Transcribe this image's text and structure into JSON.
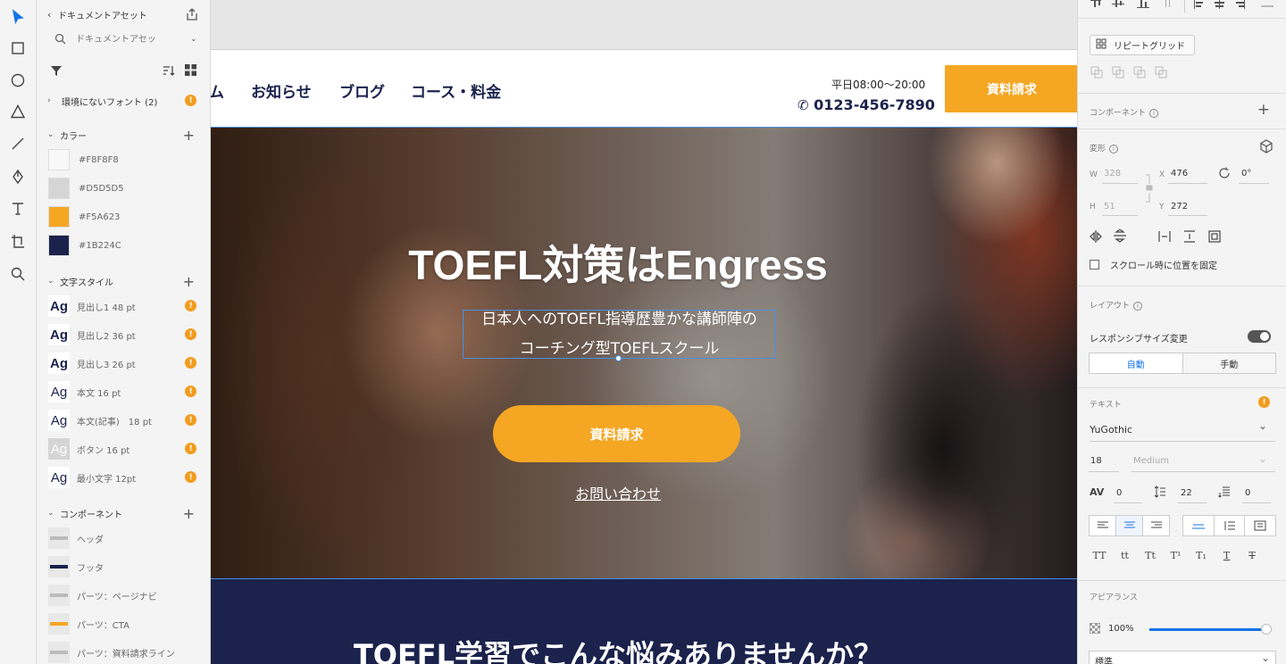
{
  "assets": {
    "back_label": "ドキュメントアセット",
    "search_placeholder": "ドキュメントアセッ",
    "missing_fonts": "環境にないフォント (2)",
    "colors_title": "カラー",
    "colors": [
      "#F8F8F8",
      "#D5D5D5",
      "#F5A623",
      "#1B224C"
    ],
    "char_styles_title": "文字スタイル",
    "char_styles": [
      {
        "glyph": "Ag",
        "label": "見出し1 48 pt",
        "weight": "bold"
      },
      {
        "glyph": "Ag",
        "label": "見出し2 36 pt",
        "weight": "bold"
      },
      {
        "glyph": "Ag",
        "label": "見出し3 26 pt",
        "weight": "bold"
      },
      {
        "glyph": "Ag",
        "label": "本文 16 pt",
        "weight": "normal"
      },
      {
        "glyph": "Ag",
        "label": "本文(記事)　18 pt",
        "weight": "normal"
      },
      {
        "glyph": "Ag",
        "label": "ボタン 16 pt",
        "weight": "normal",
        "muted": true
      },
      {
        "glyph": "Ag",
        "label": "最小文字 12pt",
        "weight": "normal"
      }
    ],
    "components_title": "コンポーネント",
    "components": [
      "ヘッダ",
      "フッタ",
      "パーツ：ページナビ",
      "パーツ：CTA",
      "パーツ：資料請求ライン"
    ]
  },
  "site": {
    "nav": [
      "ム",
      "お知らせ",
      "ブログ",
      "コース・料金"
    ],
    "hours": "平日08:00〜20:00",
    "phone": "0123-456-7890",
    "header_cta": "資料請求",
    "hero_title": "TOEFL対策はEngress",
    "hero_sub_1": "日本人へのTOEFL指導歴豊かな講師陣の",
    "hero_sub_2": "コーチング型TOEFLスクール",
    "hero_cta": "資料請求",
    "hero_link": "お問い合わせ",
    "band_title": "TOEFL学習でこんな悩みありませんか？"
  },
  "props": {
    "repeat_grid": "リピートグリッド",
    "component": "コンポーネント",
    "transform": "変形",
    "w_label": "W",
    "w": "328",
    "h_label": "H",
    "h": "51",
    "x_label": "X",
    "x": "476",
    "y_label": "Y",
    "y": "272",
    "rotation": "0°",
    "fix_scroll": "スクロール時に位置を固定",
    "layout": "レイアウト",
    "responsive": "レスポンシブサイズ変更",
    "auto": "自動",
    "manual": "手動",
    "text": "テキスト",
    "font": "YuGothic",
    "size": "18",
    "weight": "Medium",
    "tracking": "0",
    "line_height": "22",
    "para": "0",
    "case_buttons": [
      "TT",
      "tt",
      "Tt",
      "T¹",
      "T₁",
      "T",
      "T"
    ],
    "appearance": "アピアランス",
    "opacity": "100%",
    "blend": "標準",
    "opacity_level": 0.98
  }
}
